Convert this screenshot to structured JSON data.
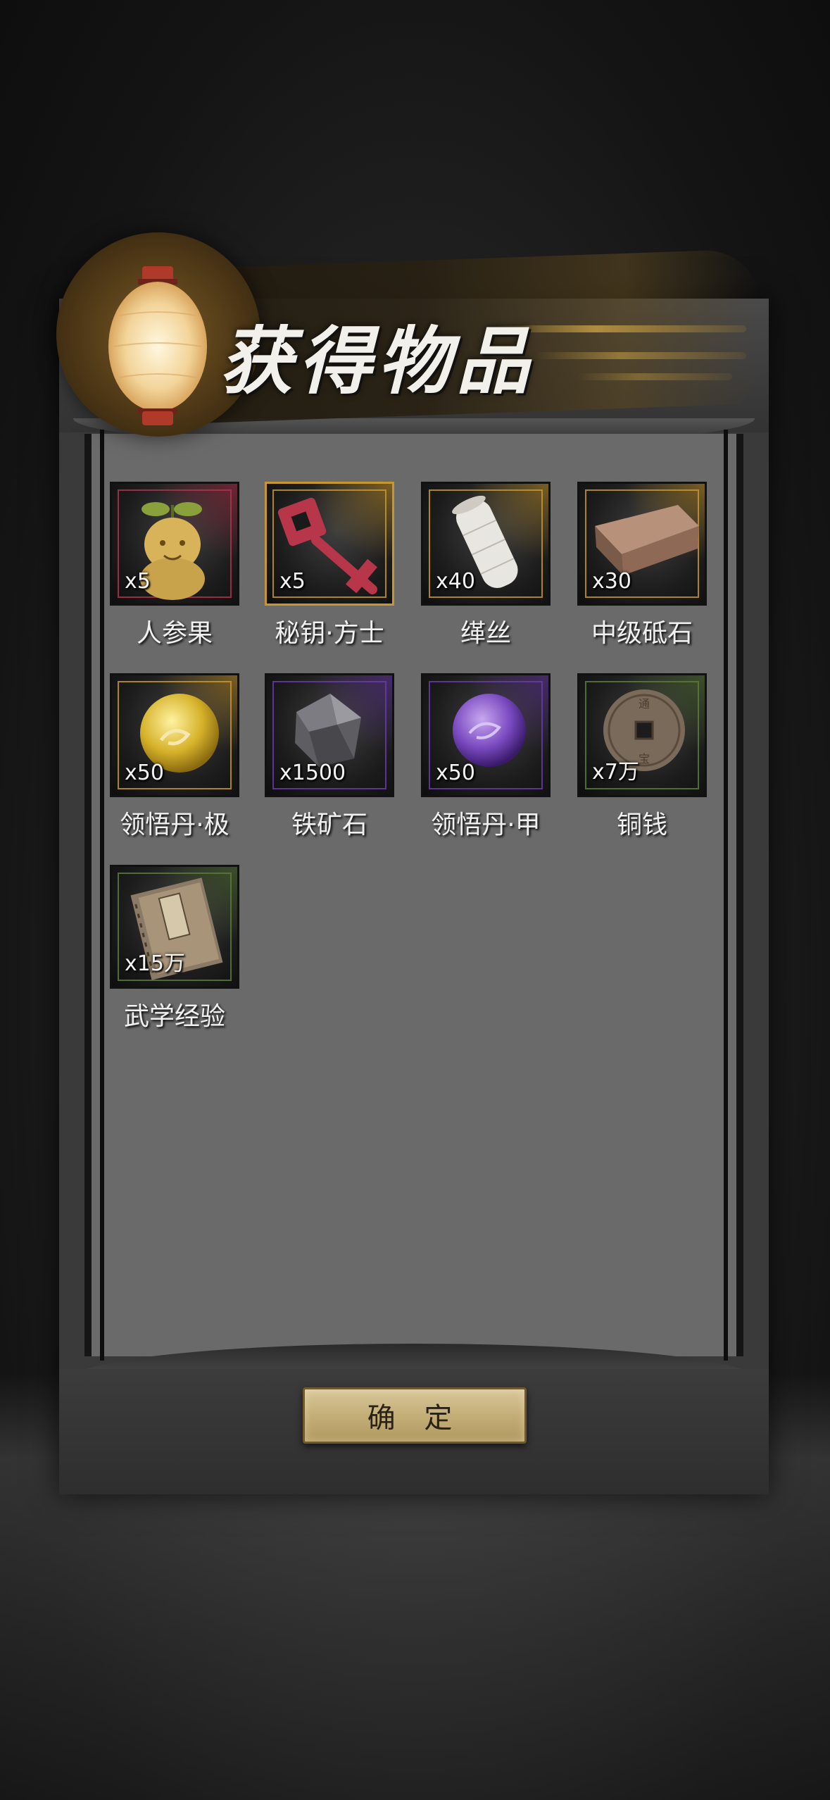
{
  "dialog": {
    "title": "获得物品",
    "confirm_label": "确 定"
  },
  "rarity_colors": {
    "red": "#b0324a",
    "gold": "#c8962e",
    "purple": "#6a3aa8",
    "green": "#5a7a3a"
  },
  "items": [
    {
      "name": "人参果",
      "qty": "x5",
      "icon": "ginseng-fruit-icon",
      "rarity": "red"
    },
    {
      "name": "秘钥·方士",
      "qty": "x5",
      "icon": "red-key-icon",
      "rarity": "gold"
    },
    {
      "name": "缂丝",
      "qty": "x40",
      "icon": "silk-spool-icon",
      "rarity": "gold"
    },
    {
      "name": "中级砥石",
      "qty": "x30",
      "icon": "whetstone-icon",
      "rarity": "gold"
    },
    {
      "name": "领悟丹·极",
      "qty": "x50",
      "icon": "golden-pill-icon",
      "rarity": "gold"
    },
    {
      "name": "铁矿石",
      "qty": "x1500",
      "icon": "iron-ore-icon",
      "rarity": "purple"
    },
    {
      "name": "领悟丹·甲",
      "qty": "x50",
      "icon": "purple-pill-icon",
      "rarity": "purple"
    },
    {
      "name": "铜钱",
      "qty": "x7万",
      "icon": "copper-coin-icon",
      "rarity": "green"
    },
    {
      "name": "武学经验",
      "qty": "x15万",
      "icon": "martial-book-icon",
      "rarity": "green"
    }
  ]
}
